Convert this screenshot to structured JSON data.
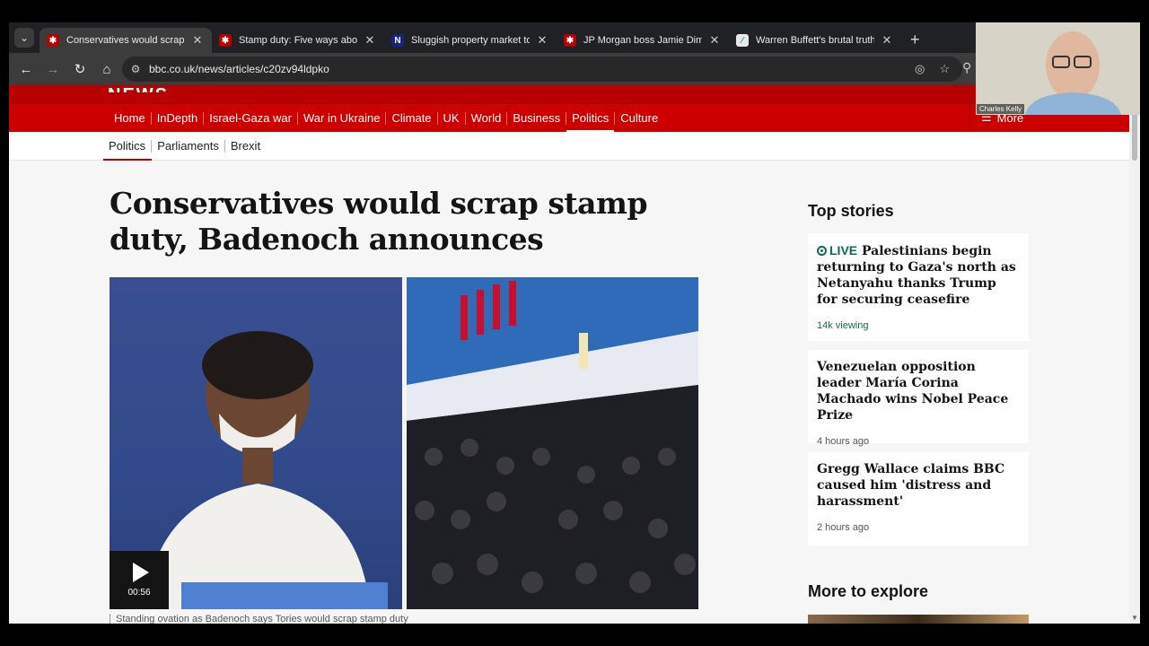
{
  "browser": {
    "tabs": [
      {
        "title": "Conservatives would scrap stamp duty",
        "favicon": "bbc-icon",
        "active": true
      },
      {
        "title": "Stamp duty: Five ways abolishing",
        "favicon": "bbc-icon",
        "active": false
      },
      {
        "title": "Sluggish property market to ro",
        "favicon": "n-icon",
        "active": false
      },
      {
        "title": "JP Morgan boss Jamie Dimon s",
        "favicon": "bbc-icon",
        "active": false
      },
      {
        "title": "Warren Buffett's brutal truth ab",
        "favicon": "document-icon",
        "active": false
      }
    ],
    "url": "bbc.co.uk/news/articles/c20zv94ldpko"
  },
  "bbc": {
    "logo_fragment": "NEWS",
    "nav": [
      "Home",
      "InDepth",
      "Israel-Gaza war",
      "War in Ukraine",
      "Climate",
      "UK",
      "World",
      "Business",
      "Politics",
      "Culture"
    ],
    "nav_current": "Politics",
    "more_label": "More",
    "subnav": [
      "Politics",
      "Parliaments",
      "Brexit"
    ]
  },
  "article": {
    "headline": "Conservatives would scrap stamp duty, Badenoch announces",
    "video_duration": "00:56",
    "caption": "Standing ovation as Badenoch says Tories would scrap stamp duty"
  },
  "sidebar": {
    "top_stories_heading": "Top stories",
    "stories": [
      {
        "live_label": "LIVE",
        "title": "Palestinians begin returning to Gaza's north as Netanyahu thanks Trump for securing ceasefire",
        "meta": "14k viewing"
      },
      {
        "live_label": "",
        "title": "Venezuelan opposition leader María Corina Machado wins Nobel Peace Prize",
        "meta": "4 hours ago"
      },
      {
        "live_label": "",
        "title": "Gregg Wallace claims BBC caused him 'distress and harassment'",
        "meta": "2 hours ago"
      }
    ],
    "more_heading": "More to explore"
  },
  "webcam": {
    "name": "Charles Kelly"
  },
  "colors": {
    "bbc_red": "#b80000",
    "bbc_nav": "#cc0000",
    "live_green": "#14684a"
  }
}
